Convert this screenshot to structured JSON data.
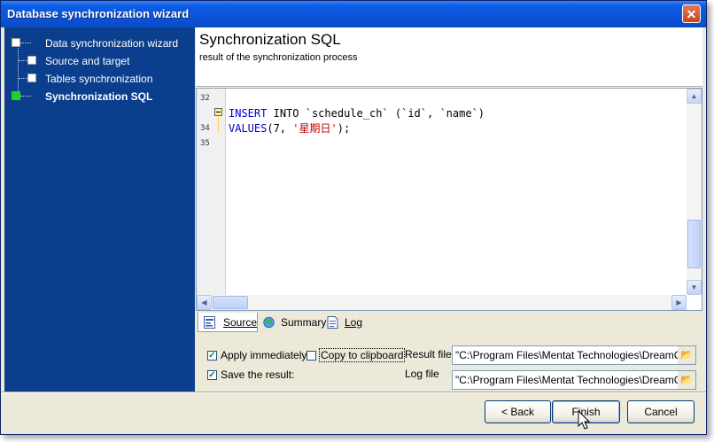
{
  "window": {
    "title": "Database synchronization wizard"
  },
  "sidebar": {
    "items": [
      {
        "label": "Data synchronization wizard"
      },
      {
        "label": "Source and target"
      },
      {
        "label": "Tables synchronization"
      },
      {
        "label": "Synchronization SQL"
      }
    ],
    "active_index": 3
  },
  "header": {
    "title": "Synchronization SQL",
    "subtitle": "result of the synchronization process"
  },
  "editor": {
    "line_numbers": [
      "32",
      "34",
      "35"
    ],
    "code": {
      "l1_kw1": "INSERT",
      "l1_kw2": "INTO",
      "l1_rest": " `schedule_ch` (`id`, `name`)",
      "l2_kw": "VALUES",
      "l2_open": "(7, ",
      "l2_str": "'星期日'",
      "l2_close": ");"
    }
  },
  "tabs": [
    {
      "label": "Source",
      "icon": "sql-icon"
    },
    {
      "label": "Summary",
      "icon": "globe-icon"
    },
    {
      "label": "Log",
      "icon": "document-icon"
    }
  ],
  "options": {
    "apply_immediately": {
      "label": "Apply immediately",
      "checked": true
    },
    "copy_to_clipboard": {
      "label": "Copy to clipboard",
      "checked": false
    },
    "save_result": {
      "label": "Save the result:",
      "checked": true
    },
    "result_file": {
      "label": "Result file",
      "value": "\"C:\\Program Files\\Mentat Technologies\\DreamCode"
    },
    "log_file": {
      "label": "Log file",
      "value": "\"C:\\Program Files\\Mentat Technologies\\DreamCode"
    }
  },
  "buttons": {
    "back": "< Back",
    "finish": "Finish",
    "cancel": "Cancel"
  }
}
